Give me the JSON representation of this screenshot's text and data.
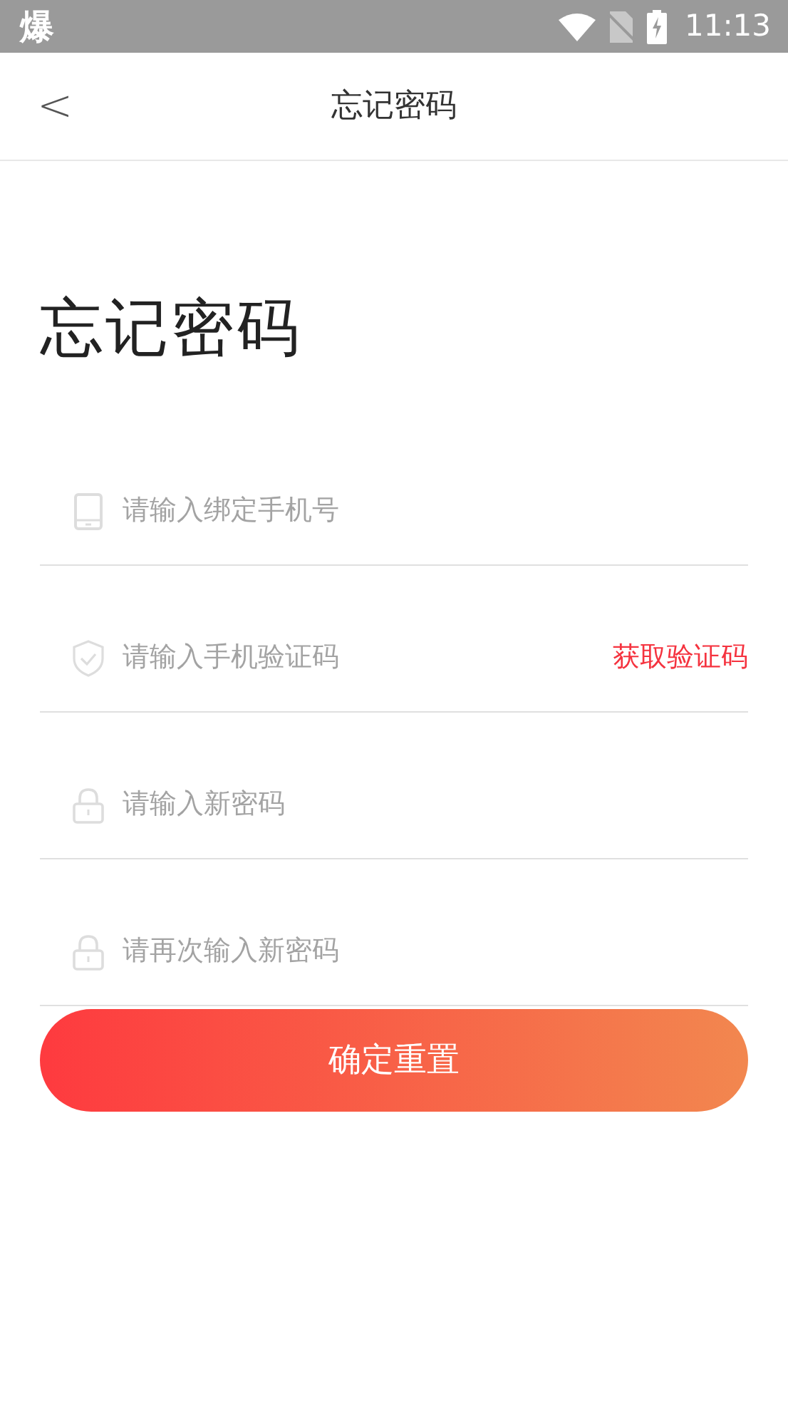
{
  "status_bar": {
    "app_glyph": "爆",
    "time": "11:13"
  },
  "header": {
    "back": "<",
    "title": "忘记密码"
  },
  "heading": "忘记密码",
  "fields": [
    {
      "kind": "phone",
      "placeholder": "请输入绑定手机号"
    },
    {
      "kind": "shield",
      "placeholder": "请输入手机验证码",
      "action": "获取验证码"
    },
    {
      "kind": "lock",
      "placeholder": "请输入新密码"
    },
    {
      "kind": "lock",
      "placeholder": "请再次输入新密码"
    }
  ],
  "submit": "确定重置"
}
